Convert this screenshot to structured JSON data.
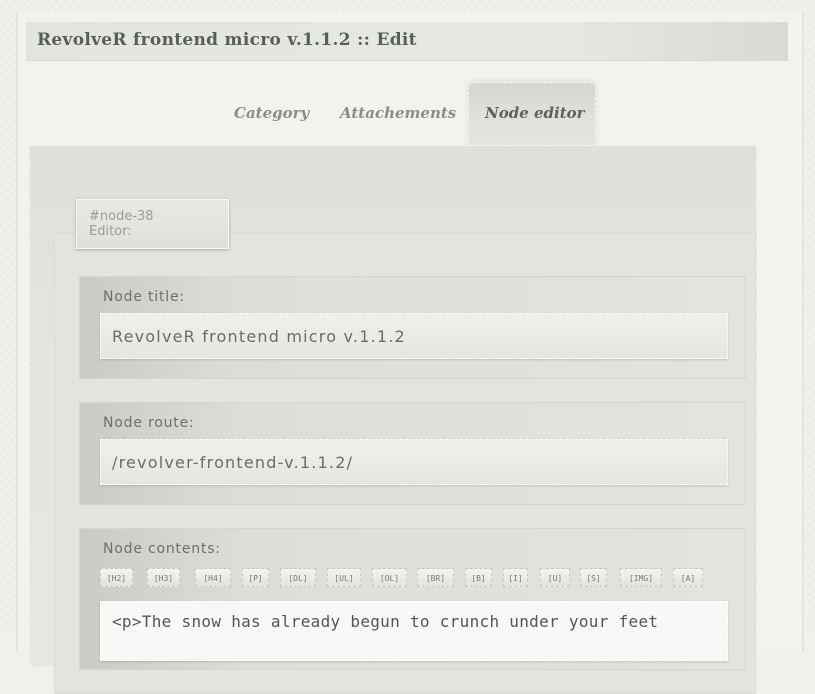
{
  "window": {
    "title": "RevolveR frontend micro v.1.1.2 :: Edit"
  },
  "tabs": [
    {
      "label": "Category",
      "active": false
    },
    {
      "label": "Attachements",
      "active": false
    },
    {
      "label": "Node editor",
      "active": true
    }
  ],
  "editor": {
    "node_id": "#node-38",
    "node_caption": "Editor:",
    "title_field": {
      "label": "Node title:",
      "value": "RevolveR frontend micro v.1.1.2"
    },
    "route_field": {
      "label": "Node route:",
      "value": "/revolver-frontend-v.1.1.2/"
    },
    "contents_field": {
      "label": "Node contents:",
      "toolbar": [
        "[H2]",
        "[H3]",
        "[H4]",
        "[P]",
        "[DL]",
        "[UL]",
        "[OL]",
        "[BR]",
        "[B]",
        "[I]",
        "[U]",
        "[S]",
        "[IMG]",
        "[A]"
      ],
      "value": "<p>The snow has already begun to crunch under your feet"
    }
  },
  "colors": {
    "background": "#f0f1ed",
    "panel": "#e3e5df",
    "text": "#6a6d68",
    "active_tab": "#d4d7cf"
  }
}
